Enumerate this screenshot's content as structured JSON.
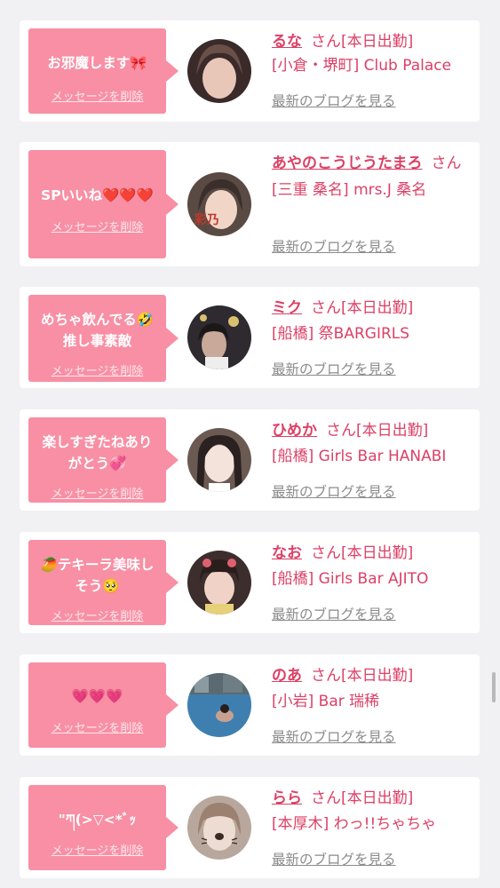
{
  "delete_label": "メッセージを削除",
  "blog_label": "最新のブログを見る",
  "san_label": "さん",
  "colors": {
    "accent": "#f88fa4",
    "link": "#dc4066",
    "muted": "#8b8b8b"
  },
  "cards": [
    {
      "message": "お邪魔します🎀",
      "name": "るな",
      "status": "[本日出勤]",
      "shop": "[小倉・堺町] Club Palace",
      "avatar_colors": [
        "#3a2a2a",
        "#e8c7b8"
      ]
    },
    {
      "message": "SPいいね❤️❤️❤️",
      "name": "あやのこうじうたまろ",
      "status": "",
      "shop": "[三重 桑名] mrs.J 桑名",
      "avatar_colors": [
        "#5a4a44",
        "#f1d6c8"
      ]
    },
    {
      "message": "めちゃ飲んでる🤣\n推し事素敵",
      "name": "ミク",
      "status": "[本日出勤]",
      "shop": "[船橋] 祭BARGIRLS",
      "avatar_colors": [
        "#2e2a30",
        "#c9a99a"
      ]
    },
    {
      "message": "楽しすぎたねあり\nがとう💞",
      "name": "ひめか",
      "status": "[本日出勤]",
      "shop": "[船橋] Girls Bar HANABI",
      "avatar_colors": [
        "#6b5a52",
        "#f4e3da"
      ]
    },
    {
      "message": "🥭テキーラ美味し\nそう🥺",
      "name": "なお",
      "status": "[本日出勤]",
      "shop": "[船橋] Girls Bar AJITO",
      "avatar_colors": [
        "#3c2e2c",
        "#f0d2c6"
      ]
    },
    {
      "message": "💗💗💗",
      "name": "のあ",
      "status": "[本日出勤]",
      "shop": "[小岩] Bar 瑞稀",
      "avatar_colors": [
        "#3f7fb0",
        "#7ec4e0"
      ]
    },
    {
      "message": "\"ཀ(>▽<*ﾞｯ",
      "name": "らら",
      "status": "[本日出勤]",
      "shop": "[本厚木] わっ!!ちゃちゃ",
      "avatar_colors": [
        "#b8a79c",
        "#ecdcd2"
      ]
    }
  ]
}
